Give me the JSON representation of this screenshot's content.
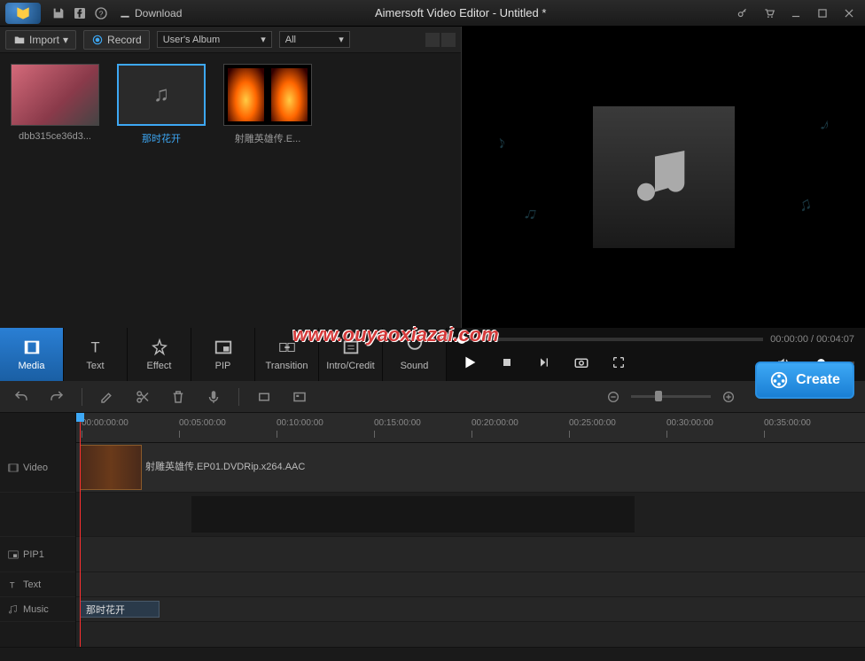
{
  "titlebar": {
    "download_label": "Download",
    "title": "Aimersoft Video Editor - Untitled *"
  },
  "media_toolbar": {
    "import_label": "Import",
    "record_label": "Record",
    "album_dropdown": "User's Album",
    "filter_dropdown": "All"
  },
  "media_items": [
    {
      "label": "dbb315ce36d3...",
      "selected": false,
      "kind": "person"
    },
    {
      "label": "那时花开",
      "selected": true,
      "kind": "music"
    },
    {
      "label": "射雕英雄传.E...",
      "selected": false,
      "kind": "fire"
    }
  ],
  "tabs": [
    {
      "id": "media",
      "label": "Media",
      "active": true
    },
    {
      "id": "text",
      "label": "Text",
      "active": false
    },
    {
      "id": "effect",
      "label": "Effect",
      "active": false
    },
    {
      "id": "pip",
      "label": "PIP",
      "active": false
    },
    {
      "id": "transition",
      "label": "Transition",
      "active": false
    },
    {
      "id": "introcredit",
      "label": "Intro/Credit",
      "active": false
    },
    {
      "id": "sound",
      "label": "Sound",
      "active": false
    }
  ],
  "playback": {
    "current_time": "00:00:00",
    "total_time": "00:04:07"
  },
  "create_label": "Create",
  "timeline": {
    "ruler": [
      "00:00:00:00",
      "00:05:00:00",
      "00:10:00:00",
      "00:15:00:00",
      "00:20:00:00",
      "00:25:00:00",
      "00:30:00:00",
      "00:35:00:00"
    ],
    "tracks": {
      "video_label": "Video",
      "pip1_label": "PIP1",
      "text_label": "Text",
      "music_label": "Music"
    },
    "video_clip_name": "射雕英雄传.EP01.DVDRip.x264.AAC",
    "music_clip_name": "那时花开"
  },
  "watermark": "www.ouyaoxiazai.com"
}
